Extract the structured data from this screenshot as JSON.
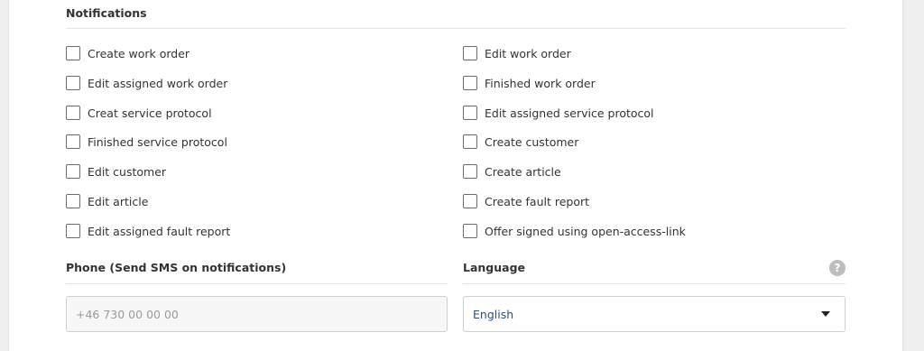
{
  "notifications": {
    "title": "Notifications",
    "left": [
      {
        "label": "Create work order",
        "checked": false
      },
      {
        "label": "Edit assigned work order",
        "checked": false
      },
      {
        "label": "Creat service protocol",
        "checked": false
      },
      {
        "label": "Finished service protocol",
        "checked": false
      },
      {
        "label": "Edit customer",
        "checked": false
      },
      {
        "label": "Edit article",
        "checked": false
      },
      {
        "label": "Edit assigned fault report",
        "checked": false
      }
    ],
    "right": [
      {
        "label": "Edit work order",
        "checked": false
      },
      {
        "label": "Finished work order",
        "checked": false
      },
      {
        "label": "Edit assigned service protocol",
        "checked": false
      },
      {
        "label": "Create customer",
        "checked": false
      },
      {
        "label": "Create article",
        "checked": false
      },
      {
        "label": "Create fault report",
        "checked": false
      },
      {
        "label": "Offer signed using open-access-link",
        "checked": false
      }
    ]
  },
  "phone": {
    "label": "Phone (Send SMS on notifications)",
    "placeholder": "+46 730 00 00 00",
    "value": ""
  },
  "language": {
    "label": "Language",
    "help_icon": "?",
    "selected": "English"
  },
  "colors": {
    "background": "#efefef",
    "panel": "#ffffff",
    "select_text": "#2a4f7a",
    "help_icon_bg": "#bdbdbd"
  }
}
